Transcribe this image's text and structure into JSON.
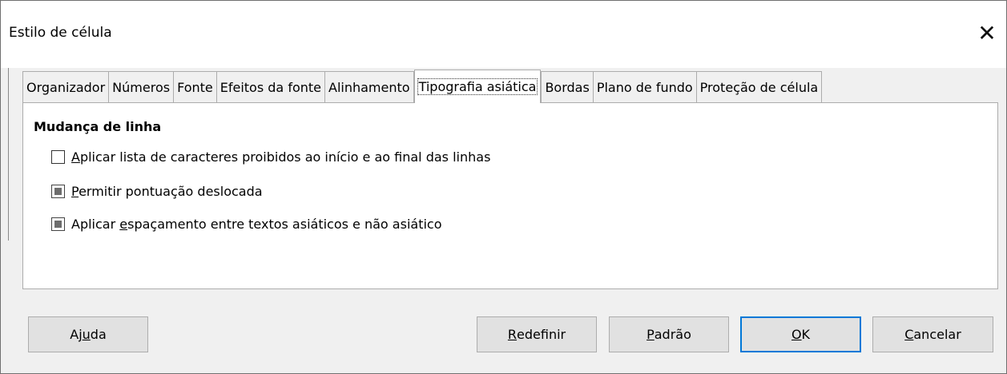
{
  "window": {
    "title": "Estilo de célula",
    "close_glyph": "✕"
  },
  "tabs": [
    {
      "label": "Organizador"
    },
    {
      "label": "Números"
    },
    {
      "label": "Fonte"
    },
    {
      "label": "Efeitos da fonte"
    },
    {
      "label": "Alinhamento"
    },
    {
      "label": "Tipografia asiática",
      "active": true
    },
    {
      "label": "Bordas"
    },
    {
      "label": "Plano de fundo"
    },
    {
      "label": "Proteção de célula"
    }
  ],
  "section": {
    "title": "Mudança de linha"
  },
  "options": [
    {
      "pre": "",
      "key": "A",
      "post": "plicar lista de caracteres proibidos ao início e ao final das linhas",
      "state": "unchecked"
    },
    {
      "pre": "",
      "key": "P",
      "post": "ermitir pontuação deslocada",
      "state": "mixed"
    },
    {
      "pre": "Aplicar ",
      "key": "e",
      "post": "spaçamento entre textos asiáticos e não asiático",
      "state": "mixed"
    }
  ],
  "buttons": {
    "help": {
      "pre": "Aj",
      "key": "u",
      "post": "da"
    },
    "reset": {
      "pre": "",
      "key": "R",
      "post": "edefinir"
    },
    "default": {
      "pre": "",
      "key": "P",
      "post": "adrão"
    },
    "ok": {
      "pre": "",
      "key": "O",
      "post": "K"
    },
    "cancel": {
      "pre": "",
      "key": "C",
      "post": "ancelar"
    }
  }
}
